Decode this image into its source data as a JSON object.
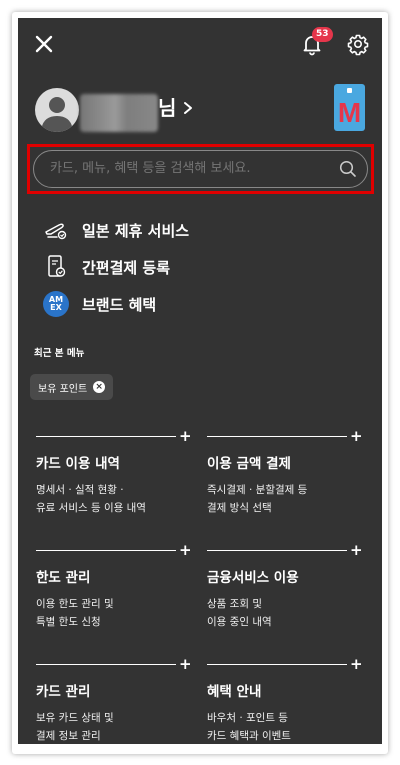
{
  "header": {
    "notification_count": "53"
  },
  "profile": {
    "name_suffix": "님",
    "card_letter": "M"
  },
  "search": {
    "placeholder": "카드, 메뉴, 혜택 등을 검색해 보세요."
  },
  "quick_menu": [
    {
      "icon": "airplane-icon",
      "label": "일본 제휴 서비스"
    },
    {
      "icon": "payment-register-icon",
      "label": "간편결제 등록"
    },
    {
      "icon": "amex-logo-icon",
      "label": "브랜드 혜택",
      "logo_text": "AM EX"
    }
  ],
  "recent": {
    "title": "최근 본 메뉴",
    "chips": [
      {
        "label": "보유 포인트",
        "remove": "×"
      }
    ]
  },
  "menu_sections": [
    {
      "title": "카드 이용 내역",
      "lines": [
        "명세서 · 실적 현황 ·",
        "유료 서비스 등 이용 내역"
      ],
      "expand": "+"
    },
    {
      "title": "이용 금액 결제",
      "lines": [
        "즉시결제 · 분할결제 등",
        "결제 방식 선택"
      ],
      "expand": "+"
    },
    {
      "title": "한도 관리",
      "lines": [
        "이용 한도 관리 및",
        "특별 한도 신청"
      ],
      "expand": "+"
    },
    {
      "title": "금융서비스 이용",
      "lines": [
        "상품 조회 및",
        "이용 중인 내역"
      ],
      "expand": "+"
    },
    {
      "title": "카드 관리",
      "lines": [
        "보유 카드 상태 및",
        "결제 정보 관리"
      ],
      "expand": "+"
    },
    {
      "title": "혜택 안내",
      "lines": [
        "바우처 · 포인트 등",
        "카드 혜택과 이벤트"
      ],
      "expand": "+"
    }
  ],
  "colors": {
    "background": "#333333",
    "badge": "#e5364b",
    "highlight": "#e00000",
    "amex": "#2a74c9"
  }
}
